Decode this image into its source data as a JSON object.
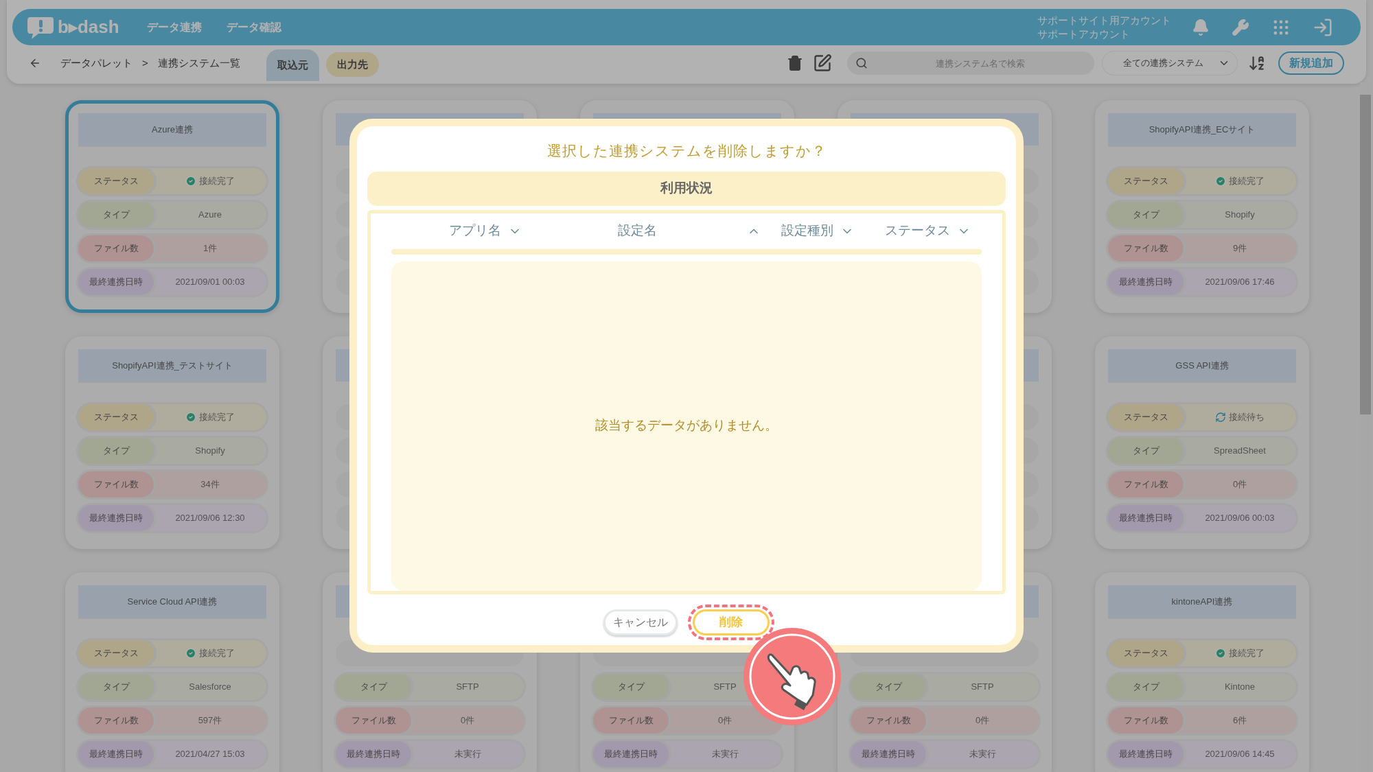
{
  "header": {
    "logo": "b▸dash",
    "nav": [
      {
        "label": "データ連携"
      },
      {
        "label": "データ確認"
      }
    ],
    "account": [
      "サポートサイト用アカウント",
      "サポートアカウント"
    ]
  },
  "subbar": {
    "breadcrumb": [
      "データパレット",
      ">",
      "連携システム一覧"
    ],
    "tabs": [
      {
        "label": "取込元",
        "selected": true
      },
      {
        "label": "出力先",
        "selected": false
      }
    ],
    "search": {
      "placeholder": "連携システム名で検索"
    },
    "filter": "全ての連携システム",
    "add_button": "新規追加"
  },
  "card_rows": [
    {
      "left": {
        "title": "Azure連携",
        "selected": true,
        "fields": [
          {
            "kind": "status",
            "label": "ステータス",
            "value": "接続完了",
            "connected": true
          },
          {
            "kind": "type",
            "label": "タイプ",
            "value": "Azure"
          },
          {
            "kind": "files",
            "label": "ファイル数",
            "value": "1件"
          },
          {
            "kind": "last",
            "label": "最終連携日時",
            "value": "2021/09/01 00:03"
          }
        ]
      },
      "right": {
        "title": "ShopifyAPI連携_ECサイト",
        "selected": false,
        "fields": [
          {
            "kind": "status",
            "label": "ステータス",
            "value": "接続完了",
            "connected": true
          },
          {
            "kind": "type",
            "label": "タイプ",
            "value": "Shopify"
          },
          {
            "kind": "files",
            "label": "ファイル数",
            "value": "9件"
          },
          {
            "kind": "last",
            "label": "最終連携日時",
            "value": "2021/09/06 17:46"
          }
        ]
      }
    },
    {
      "left": {
        "title": "ShopifyAPI連携_テストサイト",
        "selected": false,
        "fields": [
          {
            "kind": "status",
            "label": "ステータス",
            "value": "接続完了",
            "connected": true
          },
          {
            "kind": "type",
            "label": "タイプ",
            "value": "Shopify"
          },
          {
            "kind": "files",
            "label": "ファイル数",
            "value": "34件"
          },
          {
            "kind": "last",
            "label": "最終連携日時",
            "value": "2021/09/06 12:30"
          }
        ]
      },
      "right": {
        "title": "GSS API連携",
        "selected": false,
        "fields": [
          {
            "kind": "status",
            "label": "ステータス",
            "value": "接続待ち",
            "connected": false
          },
          {
            "kind": "type",
            "label": "タイプ",
            "value": "SpreadSheet"
          },
          {
            "kind": "files",
            "label": "ファイル数",
            "value": "0件"
          },
          {
            "kind": "last",
            "label": "最終連携日時",
            "value": "2021/09/06 00:03"
          }
        ]
      }
    },
    {
      "left": {
        "title": "Service Cloud API連携",
        "selected": false,
        "fields": [
          {
            "kind": "status",
            "label": "ステータス",
            "value": "接続完了",
            "connected": true
          },
          {
            "kind": "type",
            "label": "タイプ",
            "value": "Salesforce"
          },
          {
            "kind": "files",
            "label": "ファイル数",
            "value": "597件"
          },
          {
            "kind": "last",
            "label": "最終連携日時",
            "value": "2021/04/27 15:03"
          }
        ]
      },
      "middle": [
        {
          "selected": false,
          "fields": [
            {
              "kind": "type",
              "label": "タイプ",
              "value": "SFTP"
            },
            {
              "kind": "files",
              "label": "ファイル数",
              "value": "0件"
            },
            {
              "kind": "last",
              "label": "最終連携日時",
              "value": "未実行"
            }
          ]
        },
        {
          "selected": false,
          "fields": [
            {
              "kind": "type",
              "label": "タイプ",
              "value": "SFTP"
            },
            {
              "kind": "files",
              "label": "ファイル数",
              "value": "0件"
            },
            {
              "kind": "last",
              "label": "最終連携日時",
              "value": "未実行"
            }
          ]
        },
        {
          "selected": false,
          "fields": [
            {
              "kind": "type",
              "label": "タイプ",
              "value": "SFTP"
            },
            {
              "kind": "files",
              "label": "ファイル数",
              "value": "0件"
            },
            {
              "kind": "last",
              "label": "最終連携日時",
              "value": "未実行"
            }
          ]
        }
      ],
      "right": {
        "title": "kintoneAPI連携",
        "selected": false,
        "fields": [
          {
            "kind": "status",
            "label": "ステータス",
            "value": "接続完了",
            "connected": true
          },
          {
            "kind": "type",
            "label": "タイプ",
            "value": "Kintone"
          },
          {
            "kind": "files",
            "label": "ファイル数",
            "value": "6件"
          },
          {
            "kind": "last",
            "label": "最終連携日時",
            "value": "2021/09/06 14:45"
          }
        ]
      }
    }
  ],
  "dialog": {
    "title": "選択した連携システムを削除しますか？",
    "section": "利用状況",
    "columns": [
      {
        "label": "アプリ名",
        "ascending": false
      },
      {
        "label": "設定名",
        "ascending": true
      },
      {
        "label": "設定種別",
        "ascending": false
      },
      {
        "label": "ステータス",
        "ascending": false
      }
    ],
    "empty_message": "該当するデータがありません。",
    "buttons": [
      {
        "kind": "cancel",
        "label": "キャンセル",
        "highlighted": false
      },
      {
        "kind": "delete",
        "label": "削除",
        "highlighted": true
      }
    ]
  }
}
